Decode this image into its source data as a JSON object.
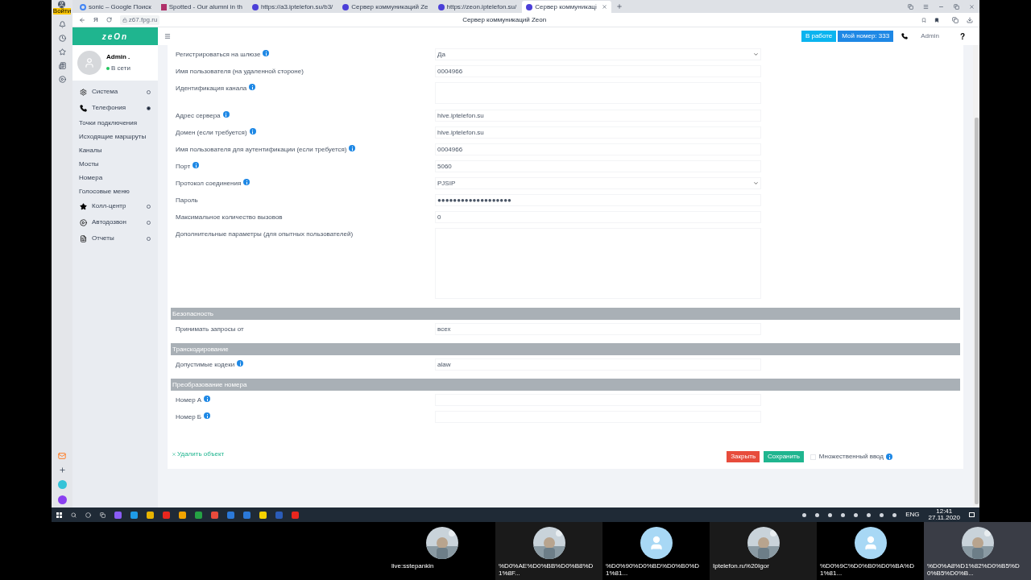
{
  "browser": {
    "profile_badge": "Войти",
    "tabs": [
      {
        "label": "sonic – Google Поиск",
        "selected": false
      },
      {
        "label": "Spotted - Our alumni in th",
        "selected": false
      },
      {
        "label": "https://a3.iptelefon.su/b3/",
        "selected": false
      },
      {
        "label": "Сервер коммуникаций Ze",
        "selected": false
      },
      {
        "label": "https://zeon.iptelefon.su/",
        "selected": false
      },
      {
        "label": "Сервер коммуникаці",
        "selected": true
      }
    ],
    "address": "z67.fpg.ru",
    "page_title": "Сервер коммуникаций Zeon",
    "nav_letter": "Я"
  },
  "header": {
    "logo": "zeOn",
    "status_button": "В работе",
    "number_button": "Мой номер: 333",
    "user": "Admin",
    "help": "?"
  },
  "profile": {
    "name": "Admin .",
    "status": "В сети",
    "online": true
  },
  "sidebar": [
    {
      "kind": "section",
      "label": "Система",
      "expanded": false
    },
    {
      "kind": "section",
      "label": "Телефония",
      "expanded": true
    },
    {
      "kind": "sub",
      "label": "Точки подключения"
    },
    {
      "kind": "sub",
      "label": "Исходящие маршруты"
    },
    {
      "kind": "sub",
      "label": "Каналы"
    },
    {
      "kind": "sub",
      "label": "Мосты"
    },
    {
      "kind": "sub",
      "label": "Номера"
    },
    {
      "kind": "sub",
      "label": "Голосовые меню"
    },
    {
      "kind": "section",
      "label": "Колл-центр",
      "expanded": false
    },
    {
      "kind": "section",
      "label": "Автодозвон",
      "expanded": false
    },
    {
      "kind": "section",
      "label": "Отчеты",
      "expanded": false
    }
  ],
  "form": [
    {
      "kind": "select",
      "label": "Регистрироваться на шлюзе",
      "info": true,
      "value": "Да"
    },
    {
      "kind": "input",
      "label": "Имя пользователя (на удаленной стороне)",
      "info": false,
      "value": "0004966"
    },
    {
      "kind": "textarea",
      "label": "Идентификация канала",
      "info": true
    },
    {
      "kind": "input",
      "label": "Адрес сервера",
      "info": true,
      "value": "hive.iptelefon.su"
    },
    {
      "kind": "input",
      "label": "Домен (если требуется)",
      "info": true,
      "value": "hive.iptelefon.su"
    },
    {
      "kind": "input",
      "label": "Имя пользователя для аутентификации (если требуется)",
      "info": true,
      "value": "0004966"
    },
    {
      "kind": "input",
      "label": "Порт",
      "info": true,
      "value": "5060"
    },
    {
      "kind": "select",
      "label": "Протокол соединения",
      "info": true,
      "value": "PJSIP"
    },
    {
      "kind": "input",
      "label": "Пароль",
      "info": false,
      "value": "●●●●●●●●●●●●●●●●●●●"
    },
    {
      "kind": "input",
      "label": "Максимальное количество вызовов",
      "info": false,
      "value": "0"
    },
    {
      "kind": "textarea",
      "label": "Дополнительные параметры (для опытных пользователей)",
      "info": false
    },
    {
      "kind": "heading",
      "label": "Безопасность"
    },
    {
      "kind": "input",
      "label": "Принимать запросы от",
      "info": false,
      "value": "всех"
    },
    {
      "kind": "heading",
      "label": "Транскодирование"
    },
    {
      "kind": "input",
      "label": "Допустимые кодеки",
      "info": true,
      "value": "alaw"
    },
    {
      "kind": "heading",
      "label": "Преобразование номера"
    },
    {
      "kind": "input",
      "label": "Номер А",
      "info": true
    },
    {
      "kind": "input",
      "label": "Номер Б",
      "info": true
    }
  ],
  "footer": {
    "delete": "Удалить объект",
    "close": "Закрыть",
    "save": "Сохранить",
    "multi_label": "Множественный ввод",
    "multi_checked": false
  },
  "taskbar": {
    "language": "ENG",
    "time": "12:41",
    "date": "27.11.2020"
  },
  "participants": [
    {
      "name": "live:sstepankin",
      "selected": false
    },
    {
      "name": "%D0%AE%D0%BB%D0%B8%D1%8F...",
      "selected": false
    },
    {
      "name": "%D0%90%D0%BD%D0%B0%D1%81...",
      "kind": "default",
      "selected": false
    },
    {
      "name": "Iptelefon.ru%20Igor",
      "selected": false
    },
    {
      "name": "%D0%9C%D0%B0%D0%BA%D1%81...",
      "kind": "default",
      "selected": false
    },
    {
      "name": "%D0%A8%D1%82%D0%B5%D0%B5%D0%B...",
      "selected": true
    }
  ]
}
